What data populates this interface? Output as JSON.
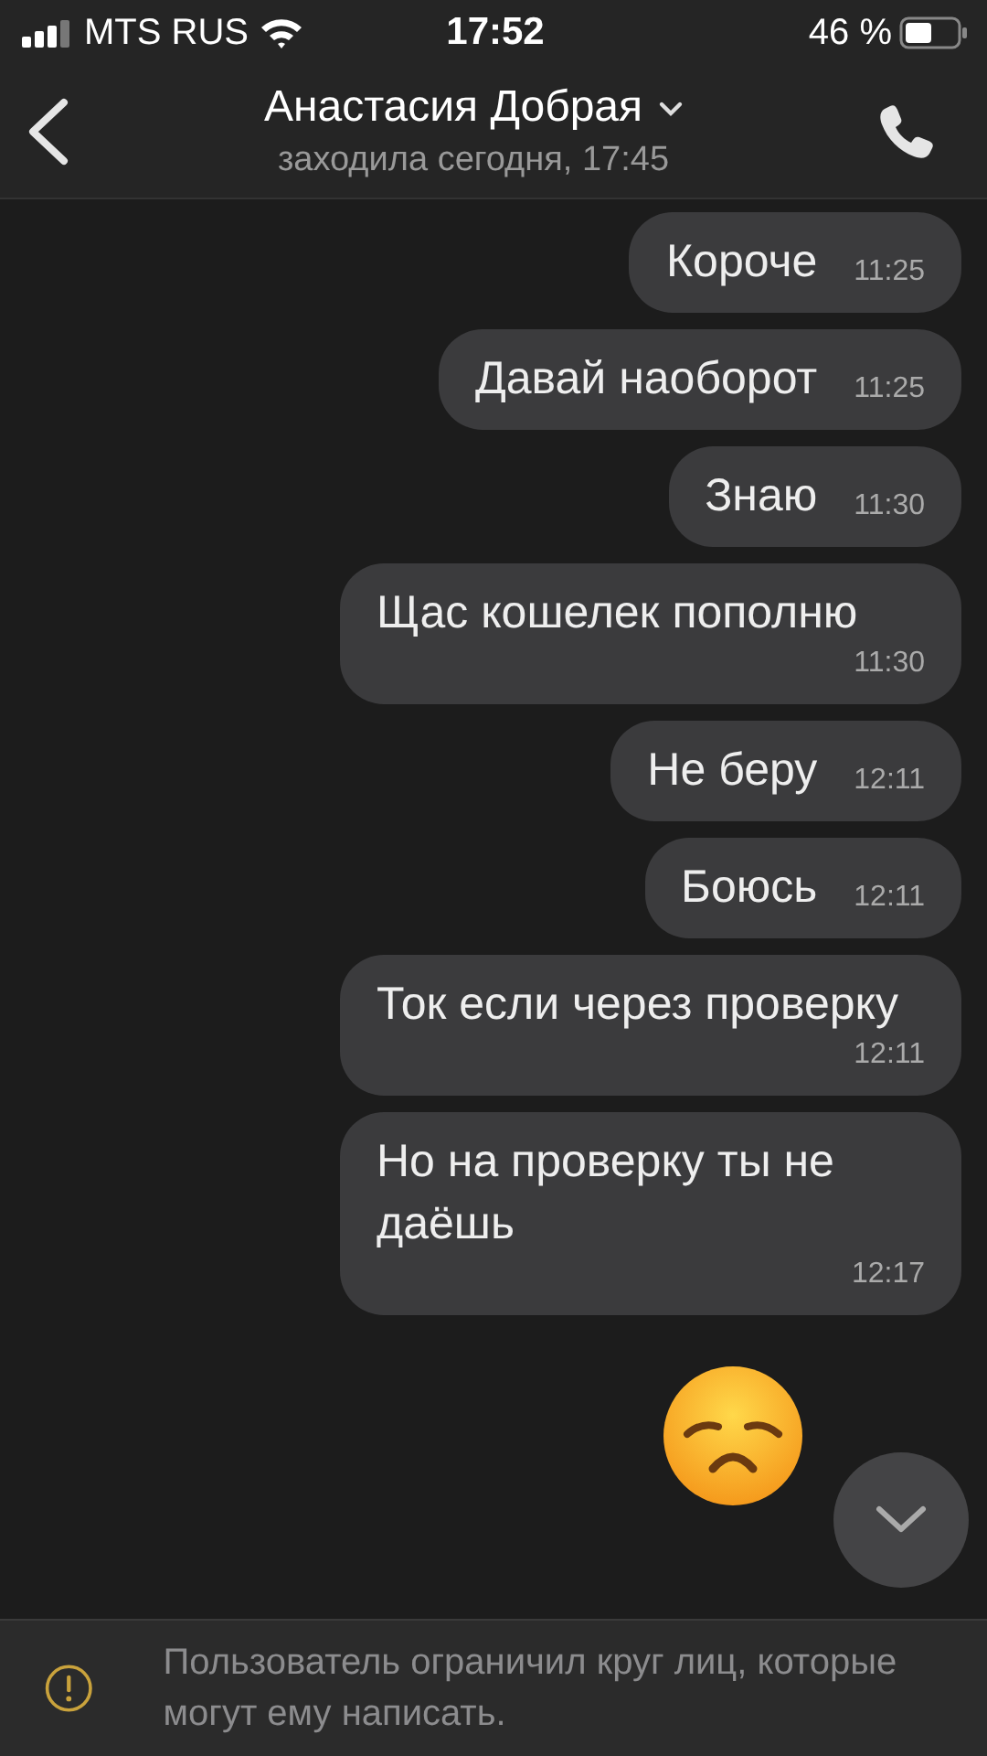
{
  "status_bar": {
    "carrier": "MTS RUS",
    "time": "17:52",
    "battery": "46 %"
  },
  "header": {
    "name": "Анастасия Добрая",
    "status": "заходила сегодня, 17:45"
  },
  "messages": [
    {
      "kind": "text",
      "text": "Короче",
      "time": "11:25"
    },
    {
      "kind": "text",
      "text": "Давай наоборот",
      "time": "11:25"
    },
    {
      "kind": "text",
      "text": "Знаю",
      "time": "11:30"
    },
    {
      "kind": "text",
      "text": "Щас кошелек пополню",
      "time": "11:30"
    },
    {
      "kind": "text",
      "text": "Не беру",
      "time": "12:11"
    },
    {
      "kind": "text",
      "text": "Боюсь",
      "time": "12:11"
    },
    {
      "kind": "text",
      "text": "Ток если через проверку",
      "time": "12:11"
    },
    {
      "kind": "text",
      "text": "Но на проверку ты не даёшь",
      "time": "12:17"
    },
    {
      "kind": "emoji"
    }
  ],
  "notice": {
    "text": "Пользователь ограничил круг лиц, которые могут ему написать."
  }
}
